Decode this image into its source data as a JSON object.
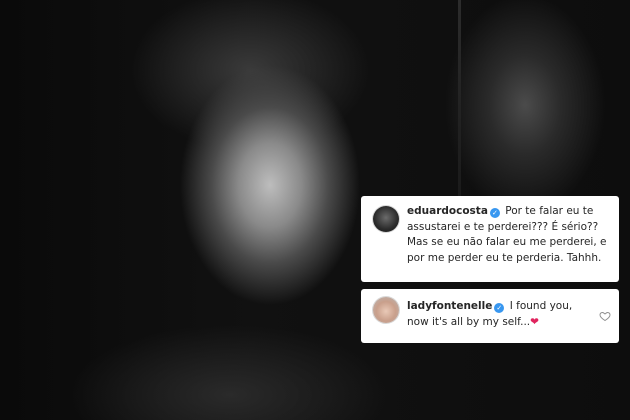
{
  "comments": [
    {
      "username": "eduardocosta",
      "text": "Por te falar eu te assustarei e te perderei??? É sério?? Mas se eu não falar eu me perderei, e por me perder eu te perderia. Tahhh."
    },
    {
      "username": "ladyfontenelle",
      "text": "I found you, now it's all by my self...",
      "emoji": "❤"
    }
  ],
  "icons": {
    "verified": "verified-badge-icon",
    "like": "heart-outline-icon"
  },
  "colors": {
    "verified_blue": "#3897f0",
    "heart_red": "#e0245e"
  }
}
